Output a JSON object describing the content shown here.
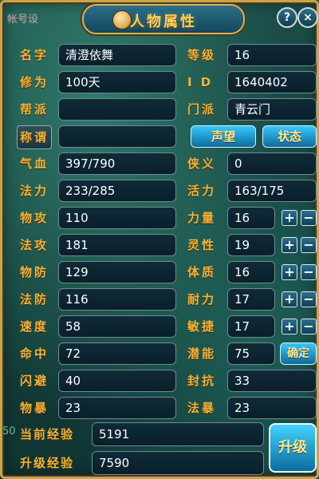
{
  "header": {
    "fragment": "帐号设",
    "title": "人物属性",
    "help": "?",
    "close": "×"
  },
  "profile": {
    "name_label": "名字",
    "name_value": "清澄依舞",
    "level_label": "等级",
    "level_value": "16",
    "cultivation_label": "修为",
    "cultivation_value": "100天",
    "id_label": "I D",
    "id_value": "1640402",
    "guild_label": "帮派",
    "guild_value": "",
    "sect_label": "门派",
    "sect_value": "青云门",
    "title_label": "称谓",
    "title_value": ""
  },
  "buttons": {
    "reputation": "声望",
    "status": "状态",
    "confirm": "确定",
    "upgrade": "升级",
    "plus": "+",
    "minus": "−"
  },
  "stats": {
    "hp_label": "气血",
    "hp_value": "397/790",
    "chivalry_label": "侠义",
    "chivalry_value": "0",
    "mp_label": "法力",
    "mp_value": "233/285",
    "vitality_label": "活力",
    "vitality_value": "163/175",
    "patk_label": "物攻",
    "patk_value": "110",
    "mattk_label": "法攻",
    "mattk_value": "181",
    "pdef_label": "物防",
    "pdef_value": "129",
    "mdef_label": "法防",
    "mdef_value": "116",
    "speed_label": "速度",
    "speed_value": "58",
    "hit_label": "命中",
    "hit_value": "72",
    "dodge_label": "闪避",
    "dodge_value": "40",
    "pcrit_label": "物暴",
    "pcrit_value": "23",
    "mcrit_label": "法暴",
    "mcrit_value": "23",
    "str_label": "力量",
    "str_value": "16",
    "spi_label": "灵性",
    "spi_value": "19",
    "con_label": "体质",
    "con_value": "16",
    "end_label": "耐力",
    "end_value": "17",
    "agi_label": "敏捷",
    "agi_value": "17",
    "potential_label": "潜能",
    "potential_value": "75",
    "seal_label": "封抗",
    "seal_value": "33"
  },
  "experience": {
    "current_label": "当前经验",
    "current_value": "5191",
    "upgrade_label": "升级经验",
    "upgrade_value": "7590"
  },
  "left_stub": "50"
}
